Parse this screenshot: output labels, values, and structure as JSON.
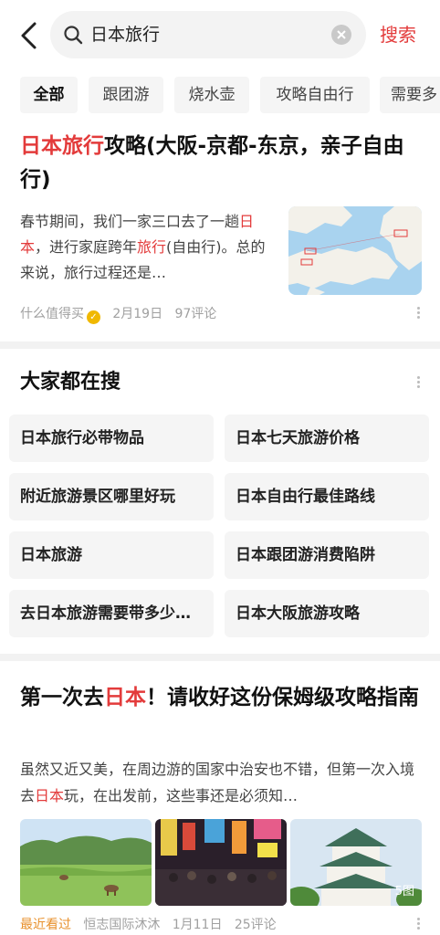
{
  "header": {
    "back_icon": "chevron-left-icon",
    "search_query": "日本旅行",
    "search_button": "搜索"
  },
  "tabs": [
    "全部",
    "跟团游",
    "烧水壶",
    "攻略自由行",
    "需要多"
  ],
  "article1": {
    "title_highlight": "日本旅行",
    "title_rest": "攻略(大阪-京都-东京，亲子自由行)",
    "desc_parts": [
      "春节期间，我们一家三口去了一趟",
      "日本",
      "，进行家庭跨年",
      "旅行",
      "(自由行)。总的来说，旅行过程还是…"
    ],
    "source": "什么值得买",
    "date": "2月19日",
    "comments": "97评论"
  },
  "hot_searches": {
    "title": "大家都在搜",
    "items": [
      "日本旅行必带物品",
      "日本七天旅游价格",
      "附近旅游景区哪里好玩",
      "日本自由行最佳路线",
      "日本旅游",
      "日本跟团游消费陷阱",
      "去日本旅游需要带多少…",
      "日本大阪旅游攻略"
    ]
  },
  "article2": {
    "title_parts": [
      "第一次去",
      "日本",
      "！请收好这份保姆级攻略指南"
    ],
    "desc_parts": [
      "虽然又近又美，在周边游的国家中治安也不错，但第一次入境去",
      "日本",
      "玩，在出发前，这些事还是必须知…"
    ],
    "image_count": "5图",
    "recent_label": "最近看过",
    "source": "恒志国际沐沐",
    "date": "1月11日",
    "comments": "25评论"
  },
  "colors": {
    "accent": "#e33b3b",
    "recent": "#e8912d"
  }
}
